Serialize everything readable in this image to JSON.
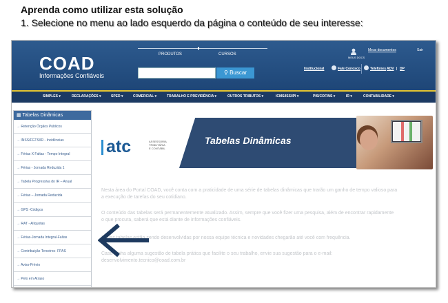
{
  "heading": "Aprenda como utilizar esta solução",
  "instruction": "1. Selecione no menu ao lado esquerdo da página o conteúdo de seu interesse:",
  "header": {
    "logo_main": "COAD",
    "logo_sub": "Informações Confiáveis",
    "top_links": [
      "PRODUTOS",
      "CURSOS"
    ],
    "search_placeholder": "",
    "search_button": "Buscar",
    "user_label": "MEUS DOCS",
    "my_documents": "Meus documentos",
    "logout": "Sair",
    "institucional": "Institucional",
    "fale_conosco": "Fale Conosco",
    "telefones": "Telefones",
    "adv": "ADV",
    "dp": "DP",
    "link_sep": "|"
  },
  "nav": [
    "SIMPLES",
    "DECLARAÇÕES",
    "SPED",
    "COMERCIAL",
    "TRABALHO E PREVIDÊNCIA",
    "OUTROS TRIBUTOS",
    "ICMS/ISS/IPI",
    "PIS/COFINS",
    "IR",
    "CONTABILIDADE"
  ],
  "sidebar": {
    "title": "Tabelas Dinâmicas",
    "items": [
      "Retenção Órgãos Públicos",
      "INSS/FGTS/IR - Incidências",
      "Férias X Faltas - Tempo Integral",
      "Férias - Jornada Reduzida 1",
      "Tabela Progressiva do IR – Anual",
      "Férias – Jornada Reduzida",
      "GPS -Códigos",
      "RAT - Alíquotas",
      "Férias-Jornada Integral-Faltas",
      "Contribuição Terceiros- FPAS",
      "Aviso-Prévio",
      "Pelo em Atraso"
    ]
  },
  "banner": {
    "atc": "atc",
    "atc_sub": [
      "ASSESSORIA",
      "TRIBUTÁRIA",
      "E CONTÁBIL"
    ],
    "title": "Tabelas Dinâmicas"
  },
  "paragraphs": {
    "p1_l1": "Nesta área do Portal COAD, você conta com a praticidade de uma série de tabelas dinâmicas que trarão um ganho de tempo valioso para",
    "p1_l2": "a execução de tarefas do seu cotidiano.",
    "p2_l1": "O conteúdo das tabelas será permanentemente atualizado. Assim, sempre que você fizer uma pesquisa, além de encontrar rapidamente",
    "p2_l2": "o que procura, saberá que está diante de informações confiáveis.",
    "p3_l1": "Novas tabelas estão sendo desenvolvidas por nossa equipe técnica e novidades chegarão até você com frequência.",
    "p4_l1": "Caso tenha alguma sugestão de tabela prática que facilite o seu trabalho, envie sua sugestão para o e-mail:",
    "p4_l2": "desenvolvimento.tecnico@coad.com.br"
  },
  "colors": {
    "header_blue": "#2d5a8e",
    "nav_navy": "#1c3a63",
    "accent_yellow": "#e8c630",
    "search_blue": "#3b97d3",
    "arrow_navy": "#1e3a5f"
  }
}
